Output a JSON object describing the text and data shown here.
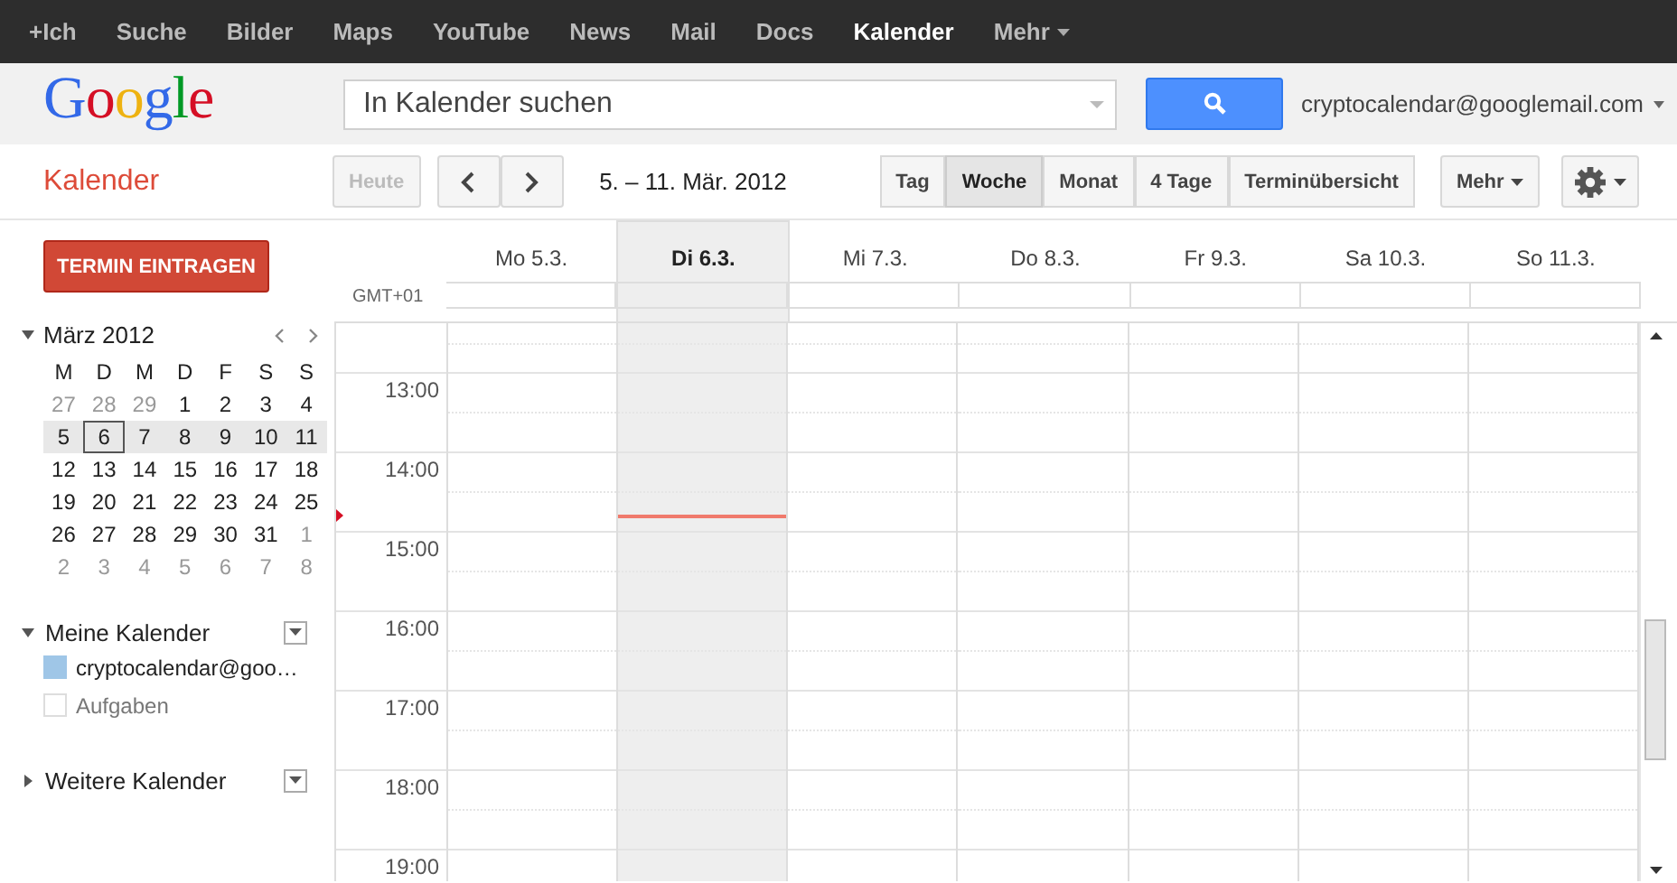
{
  "top_nav": [
    {
      "label": "+Ich",
      "selected": false
    },
    {
      "label": "Suche",
      "selected": false
    },
    {
      "label": "Bilder",
      "selected": false
    },
    {
      "label": "Maps",
      "selected": false
    },
    {
      "label": "YouTube",
      "selected": false
    },
    {
      "label": "News",
      "selected": false
    },
    {
      "label": "Mail",
      "selected": false
    },
    {
      "label": "Docs",
      "selected": false
    },
    {
      "label": "Kalender",
      "selected": true
    },
    {
      "label": "Mehr",
      "selected": false,
      "kind": "menu"
    }
  ],
  "header": {
    "logo": "Google",
    "search": {
      "placeholder": "In Kalender suchen"
    },
    "account": "cryptocalendar@googlemail.com"
  },
  "toolbar": {
    "app_title": "Kalender",
    "today_button": {
      "label": "Heute",
      "disabled": true
    },
    "date_range": "5. – 11. Mär. 2012",
    "view_tabs": [
      {
        "label": "Tag",
        "selected": false
      },
      {
        "label": "Woche",
        "selected": true
      },
      {
        "label": "Monat",
        "selected": false
      },
      {
        "label": "4 Tage",
        "selected": false
      },
      {
        "label": "Terminübersicht",
        "selected": false
      }
    ],
    "more_button": "Mehr"
  },
  "sidebar": {
    "create_button": "TERMIN EINTRAGEN",
    "mini_calendar": {
      "title": "März 2012",
      "weekdays": [
        "M",
        "D",
        "M",
        "D",
        "F",
        "S",
        "S"
      ],
      "weeks": [
        {
          "selected": false,
          "days": [
            {
              "label": "27",
              "other_month": true,
              "today": false
            },
            {
              "label": "28",
              "other_month": true,
              "today": false
            },
            {
              "label": "29",
              "other_month": true,
              "today": false
            },
            {
              "label": "1",
              "other_month": false,
              "today": false
            },
            {
              "label": "2",
              "other_month": false,
              "today": false
            },
            {
              "label": "3",
              "other_month": false,
              "today": false
            },
            {
              "label": "4",
              "other_month": false,
              "today": false
            }
          ]
        },
        {
          "selected": true,
          "days": [
            {
              "label": "5",
              "other_month": false,
              "today": false
            },
            {
              "label": "6",
              "other_month": false,
              "today": true
            },
            {
              "label": "7",
              "other_month": false,
              "today": false
            },
            {
              "label": "8",
              "other_month": false,
              "today": false
            },
            {
              "label": "9",
              "other_month": false,
              "today": false
            },
            {
              "label": "10",
              "other_month": false,
              "today": false
            },
            {
              "label": "11",
              "other_month": false,
              "today": false
            }
          ]
        },
        {
          "selected": false,
          "days": [
            {
              "label": "12",
              "other_month": false,
              "today": false
            },
            {
              "label": "13",
              "other_month": false,
              "today": false
            },
            {
              "label": "14",
              "other_month": false,
              "today": false
            },
            {
              "label": "15",
              "other_month": false,
              "today": false
            },
            {
              "label": "16",
              "other_month": false,
              "today": false
            },
            {
              "label": "17",
              "other_month": false,
              "today": false
            },
            {
              "label": "18",
              "other_month": false,
              "today": false
            }
          ]
        },
        {
          "selected": false,
          "days": [
            {
              "label": "19",
              "other_month": false,
              "today": false
            },
            {
              "label": "20",
              "other_month": false,
              "today": false
            },
            {
              "label": "21",
              "other_month": false,
              "today": false
            },
            {
              "label": "22",
              "other_month": false,
              "today": false
            },
            {
              "label": "23",
              "other_month": false,
              "today": false
            },
            {
              "label": "24",
              "other_month": false,
              "today": false
            },
            {
              "label": "25",
              "other_month": false,
              "today": false
            }
          ]
        },
        {
          "selected": false,
          "days": [
            {
              "label": "26",
              "other_month": false,
              "today": false
            },
            {
              "label": "27",
              "other_month": false,
              "today": false
            },
            {
              "label": "28",
              "other_month": false,
              "today": false
            },
            {
              "label": "29",
              "other_month": false,
              "today": false
            },
            {
              "label": "30",
              "other_month": false,
              "today": false
            },
            {
              "label": "31",
              "other_month": false,
              "today": false
            },
            {
              "label": "1",
              "other_month": true,
              "today": false
            }
          ]
        },
        {
          "selected": false,
          "days": [
            {
              "label": "2",
              "other_month": true,
              "today": false
            },
            {
              "label": "3",
              "other_month": true,
              "today": false
            },
            {
              "label": "4",
              "other_month": true,
              "today": false
            },
            {
              "label": "5",
              "other_month": true,
              "today": false
            },
            {
              "label": "6",
              "other_month": true,
              "today": false
            },
            {
              "label": "7",
              "other_month": true,
              "today": false
            },
            {
              "label": "8",
              "other_month": true,
              "today": false
            }
          ]
        }
      ]
    },
    "calendar_sections": [
      {
        "title": "Meine Kalender",
        "expanded": true,
        "items": [
          {
            "label": "cryptocalendar@goo…",
            "checked": true,
            "color": "#9fc6e7"
          },
          {
            "label": "Aufgaben",
            "checked": false
          }
        ]
      },
      {
        "title": "Weitere Kalender",
        "expanded": false
      }
    ]
  },
  "week_view": {
    "timezone": "GMT+01",
    "days": [
      {
        "label": "Mo 5.3.",
        "selected": false
      },
      {
        "label": "Di 6.3.",
        "selected": true
      },
      {
        "label": "Mi 7.3.",
        "selected": false
      },
      {
        "label": "Do 8.3.",
        "selected": false
      },
      {
        "label": "Fr 9.3.",
        "selected": false
      },
      {
        "label": "Sa 10.3.",
        "selected": false
      },
      {
        "label": "So 11.3.",
        "selected": false
      }
    ],
    "hours": [
      "13:00",
      "14:00",
      "15:00",
      "16:00",
      "17:00",
      "18:00",
      "19:00"
    ]
  }
}
